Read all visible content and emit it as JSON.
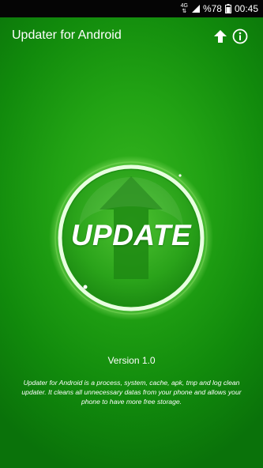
{
  "status_bar": {
    "network": "4G",
    "battery": "%78",
    "time": "00:45"
  },
  "app_bar": {
    "title": "Updater for Android",
    "upload_icon": "arrow-up-icon",
    "info_icon": "info-icon"
  },
  "main": {
    "update_button_label": "UPDATE",
    "version": "Version 1.0",
    "description": "Updater for Android is a process, system, cache, apk, tmp and log clean updater. It cleans all unnecessary datas from your phone and allows your phone to have more free storage."
  },
  "colors": {
    "background": "#1a9a12",
    "status_bar": "#050505",
    "text": "#ffffff"
  }
}
